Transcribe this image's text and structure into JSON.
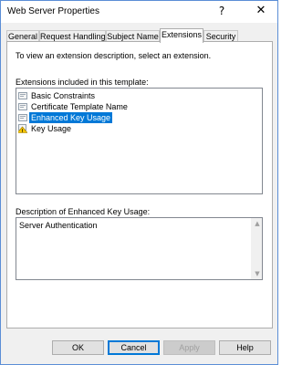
{
  "window": {
    "title": "Web Server Properties",
    "help_glyph": "?",
    "close_glyph": "✕"
  },
  "tabs": [
    {
      "label": "General",
      "active": false
    },
    {
      "label": "Request Handling",
      "active": false
    },
    {
      "label": "Subject Name",
      "active": false
    },
    {
      "label": "Extensions",
      "active": true
    },
    {
      "label": "Security",
      "active": false
    }
  ],
  "panel": {
    "intro": "To view an extension description, select an extension.",
    "extensions_label": "Extensions included in this template:",
    "extensions": [
      {
        "label": "Basic Constraints",
        "icon": "certificate-extension-icon",
        "selected": false
      },
      {
        "label": "Certificate Template Name",
        "icon": "certificate-extension-icon",
        "selected": false
      },
      {
        "label": "Enhanced Key Usage",
        "icon": "certificate-extension-icon",
        "selected": true
      },
      {
        "label": "Key Usage",
        "icon": "critical-extension-warning-icon",
        "selected": false
      }
    ],
    "description_label": "Description of Enhanced Key Usage:",
    "description_text": "Server Authentication"
  },
  "buttons": {
    "ok": "OK",
    "cancel": "Cancel",
    "apply": "Apply",
    "help": "Help"
  },
  "colors": {
    "selection": "#0078d7",
    "window_border": "#5b8ed6"
  }
}
